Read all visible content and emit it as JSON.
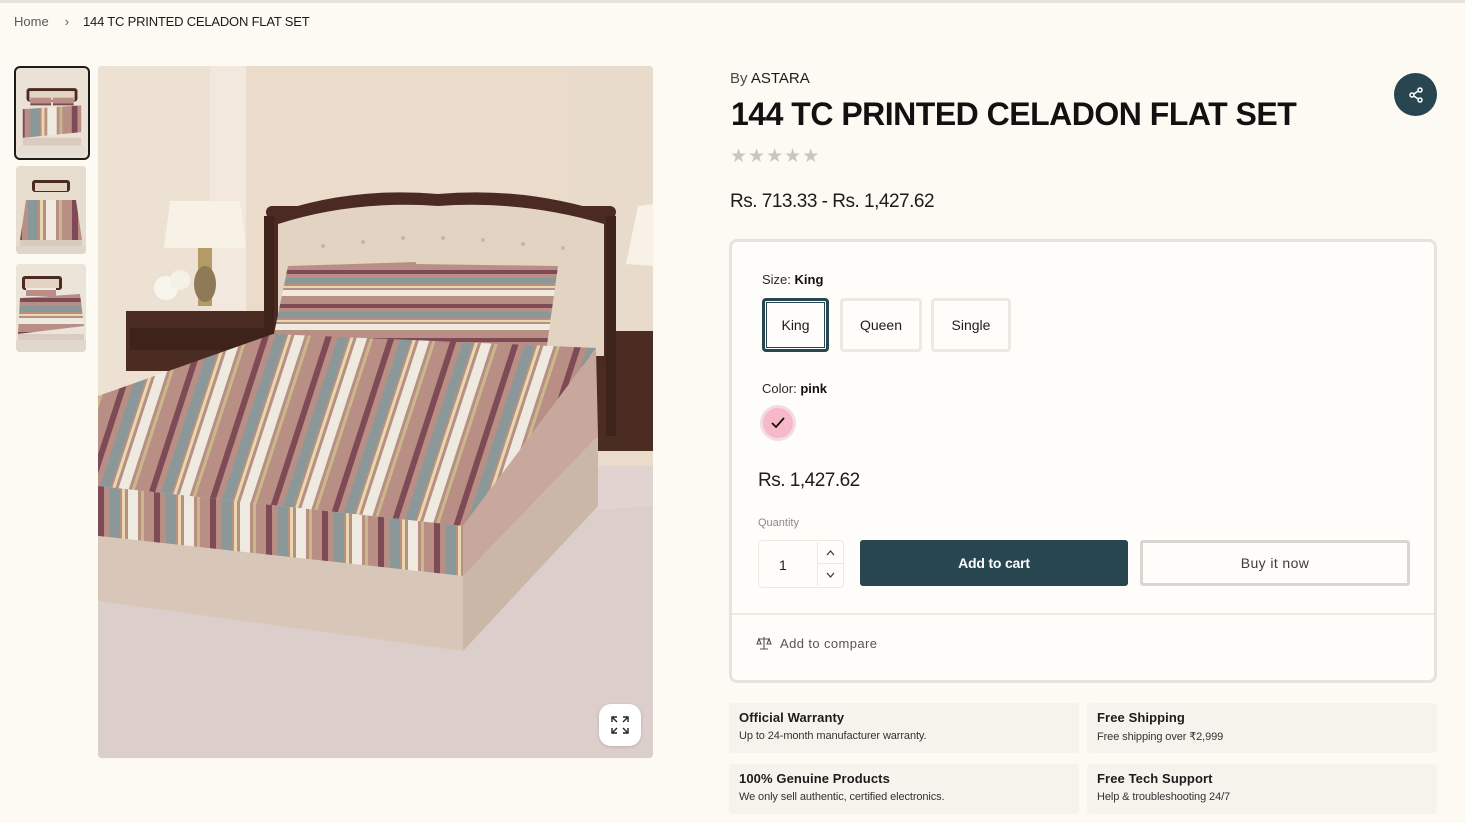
{
  "breadcrumb": {
    "home": "Home",
    "separator": "›",
    "current": "144 TC PRINTED CELADON FLAT SET"
  },
  "product": {
    "by_prefix": "By",
    "brand": "ASTARA",
    "title": "144 TC PRINTED CELADON FLAT SET",
    "rating_stars": 5,
    "star_glyph": "★",
    "price_range": "Rs. 713.33 - Rs. 1,427.62"
  },
  "options": {
    "size_label": "Size:",
    "size_selected": "King",
    "sizes": [
      "King",
      "Queen",
      "Single"
    ],
    "color_label": "Color:",
    "color_selected": "pink",
    "swatch_color": "#f7b8c8"
  },
  "purchase": {
    "price": "Rs. 1,427.62",
    "quantity_label": "Quantity",
    "quantity": "1",
    "add_to_cart": "Add to cart",
    "buy_now": "Buy it now",
    "compare": "Add to compare"
  },
  "features": [
    {
      "title": "Official Warranty",
      "desc": "Up to 24-month manufacturer warranty."
    },
    {
      "title": "Free Shipping",
      "desc": "Free shipping over ₹2,999"
    },
    {
      "title": "100% Genuine Products",
      "desc": "We only sell authentic, certified electronics."
    },
    {
      "title": "Free Tech Support",
      "desc": "Help & troubleshooting 24/7"
    }
  ],
  "colors": {
    "primary": "#274650",
    "background": "#fdf9f3",
    "border": "#e6e3de"
  },
  "icons": {
    "share": "share-icon",
    "zoom": "expand-icon",
    "compare": "scale-icon",
    "check": "check-icon"
  }
}
